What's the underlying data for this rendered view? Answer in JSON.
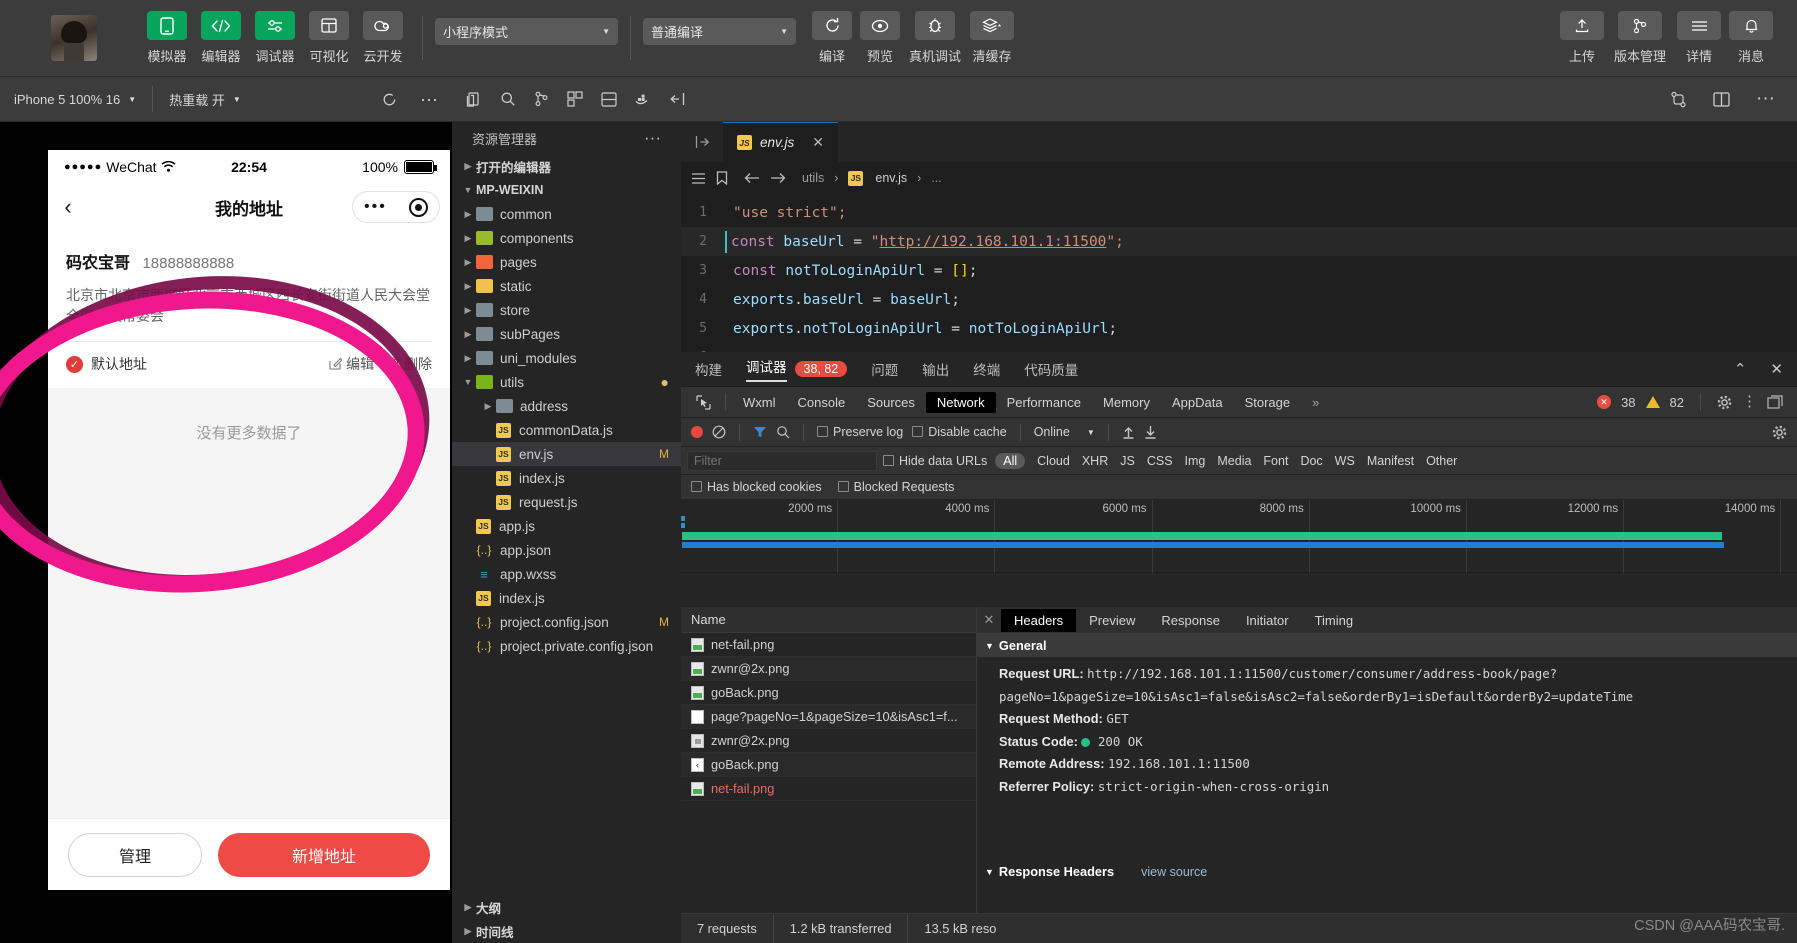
{
  "toolbar": {
    "items": [
      {
        "label": "模拟器",
        "icon": "phone-icon",
        "style": "green"
      },
      {
        "label": "编辑器",
        "icon": "code-icon",
        "style": "green"
      },
      {
        "label": "调试器",
        "icon": "debug-slider-icon",
        "style": "green"
      },
      {
        "label": "可视化",
        "icon": "layout-icon",
        "style": "grey"
      },
      {
        "label": "云开发",
        "icon": "cloud-icon",
        "style": "grey"
      }
    ],
    "mode_select": "小程序模式",
    "compile_select": "普通编译",
    "actions": [
      {
        "label": "编译",
        "icon": "refresh-icon"
      },
      {
        "label": "预览",
        "icon": "eye-icon"
      },
      {
        "label": "真机调试",
        "icon": "bug-icon"
      },
      {
        "label": "清缓存",
        "icon": "layers-icon"
      }
    ],
    "right_actions": [
      {
        "label": "上传",
        "icon": "upload-icon"
      },
      {
        "label": "版本管理",
        "icon": "git-branch-icon"
      },
      {
        "label": "详情",
        "icon": "menu-icon"
      },
      {
        "label": "消息",
        "icon": "bell-icon"
      }
    ]
  },
  "row2": {
    "device": "iPhone 5 100% 16",
    "hotreload": "热重载 开",
    "refresh_icon": "refresh-icon",
    "more_icon": "more-icon",
    "editor_icons": [
      "new-file-icon",
      "search-icon",
      "source-control-icon",
      "extensions-icon",
      "split-layout-icon",
      "docker-icon"
    ],
    "collapse_icon": "collapse-panel-icon",
    "right_icons": [
      "compare-icon",
      "split-editor-icon",
      "more-icon"
    ]
  },
  "simulator": {
    "status_bar": {
      "carrier_dots": "●●●●●",
      "carrier": "WeChat",
      "wifi_icon": "wifi-icon",
      "time": "22:54",
      "battery": "100%"
    },
    "nav": {
      "back_icon": "chevron-left-icon",
      "title": "我的地址",
      "capsule_dots": "•••",
      "capsule_circle_icon": "target-icon"
    },
    "address": {
      "name": "码农宝哥",
      "phone": "18888888888",
      "detail": "北京市北京市西城区北京市西城区西长安街街道人民大会堂全国人大常委会",
      "default_label": "默认地址",
      "default_icon": "check-circle-icon",
      "edit_label": "编辑",
      "edit_icon": "edit-icon",
      "delete_label": "删除",
      "delete_icon": "trash-icon"
    },
    "no_more": "没有更多数据了",
    "buttons": {
      "manage": "管理",
      "add": "新增地址"
    }
  },
  "explorer": {
    "title": "资源管理器",
    "more_icon": "more-icon",
    "sections": {
      "open_editors": "打开的编辑器",
      "project": "MP-WEIXIN",
      "outline": "大纲",
      "timeline": "时间线"
    },
    "tree": [
      {
        "label": "common",
        "type": "folder",
        "color": "blue",
        "depth": 1,
        "arrow": "collapsed"
      },
      {
        "label": "components",
        "type": "folder",
        "color": "green",
        "depth": 1,
        "arrow": "collapsed"
      },
      {
        "label": "pages",
        "type": "folder",
        "color": "red",
        "depth": 1,
        "arrow": "collapsed"
      },
      {
        "label": "static",
        "type": "folder",
        "color": "yellow",
        "depth": 1,
        "arrow": "collapsed"
      },
      {
        "label": "store",
        "type": "folder",
        "color": "blue",
        "depth": 1,
        "arrow": "collapsed"
      },
      {
        "label": "subPages",
        "type": "folder",
        "color": "blue",
        "depth": 1,
        "arrow": "collapsed"
      },
      {
        "label": "uni_modules",
        "type": "folder",
        "color": "blue",
        "depth": 1,
        "arrow": "collapsed"
      },
      {
        "label": "utils",
        "type": "folder",
        "color": "green2",
        "depth": 1,
        "arrow": "expanded",
        "modified_dot": true
      },
      {
        "label": "address",
        "type": "folder",
        "color": "blue",
        "depth": 2,
        "arrow": "collapsed"
      },
      {
        "label": "commonData.js",
        "type": "js",
        "depth": 2
      },
      {
        "label": "env.js",
        "type": "js",
        "depth": 2,
        "selected": true,
        "flag": "M"
      },
      {
        "label": "index.js",
        "type": "js",
        "depth": 2
      },
      {
        "label": "request.js",
        "type": "js",
        "depth": 2
      },
      {
        "label": "app.js",
        "type": "js",
        "depth": 1
      },
      {
        "label": "app.json",
        "type": "json",
        "depth": 1
      },
      {
        "label": "app.wxss",
        "type": "css",
        "depth": 1
      },
      {
        "label": "index.js",
        "type": "js",
        "depth": 1
      },
      {
        "label": "project.config.json",
        "type": "json",
        "depth": 1,
        "flag": "M"
      },
      {
        "label": "project.private.config.json",
        "type": "json",
        "depth": 1
      }
    ]
  },
  "editor": {
    "tab": {
      "name": "env.js",
      "icon": "js-icon",
      "close_icon": "close-icon"
    },
    "breadcrumb": [
      "utils",
      "env.js",
      "..."
    ],
    "breadcrumb_icons": [
      "outline-icon",
      "bookmark-icon",
      "back-arrow-icon",
      "forward-arrow-icon"
    ],
    "lines": [
      {
        "n": "1",
        "tokens": [
          {
            "t": "\"use strict\";",
            "c": "k-str"
          }
        ]
      },
      {
        "n": "2",
        "tokens": [
          {
            "t": "const",
            "c": "k-kw"
          },
          {
            "t": " ",
            "c": "k-op"
          },
          {
            "t": "baseUrl",
            "c": "k-var"
          },
          {
            "t": " = ",
            "c": "k-op"
          },
          {
            "t": "\"",
            "c": "k-str"
          },
          {
            "t": "http://192.168.101.1:11500",
            "c": "k-url"
          },
          {
            "t": "\";",
            "c": "k-str"
          }
        ],
        "current": true
      },
      {
        "n": "3",
        "tokens": [
          {
            "t": "const",
            "c": "k-kw"
          },
          {
            "t": " ",
            "c": "k-op"
          },
          {
            "t": "notToLoginApiUrl",
            "c": "k-var"
          },
          {
            "t": " = ",
            "c": "k-op"
          },
          {
            "t": "[]",
            "c": "k-br"
          },
          {
            "t": ";",
            "c": "k-op"
          }
        ]
      },
      {
        "n": "4",
        "tokens": [
          {
            "t": "exports",
            "c": "k-var"
          },
          {
            "t": ".",
            "c": "k-op"
          },
          {
            "t": "baseUrl",
            "c": "k-prop"
          },
          {
            "t": " = ",
            "c": "k-op"
          },
          {
            "t": "baseUrl",
            "c": "k-var"
          },
          {
            "t": ";",
            "c": "k-op"
          }
        ]
      },
      {
        "n": "5",
        "tokens": [
          {
            "t": "exports",
            "c": "k-var"
          },
          {
            "t": ".",
            "c": "k-op"
          },
          {
            "t": "notToLoginApiUrl",
            "c": "k-prop"
          },
          {
            "t": " = ",
            "c": "k-op"
          },
          {
            "t": "notToLoginApiUrl",
            "c": "k-var"
          },
          {
            "t": ";",
            "c": "k-op"
          }
        ]
      },
      {
        "n": "6",
        "tokens": [
          {
            "t": "",
            "c": "k-op"
          }
        ]
      }
    ]
  },
  "debugger": {
    "panel_tabs": [
      {
        "label": "构建"
      },
      {
        "label": "调试器",
        "active": true,
        "badge": "38, 82"
      },
      {
        "label": "问题"
      },
      {
        "label": "输出"
      },
      {
        "label": "终端"
      },
      {
        "label": "代码质量"
      }
    ],
    "panel_right_icons": [
      "chevron-up-icon",
      "close-icon"
    ],
    "devtools_tabs": [
      "Wxml",
      "Console",
      "Sources",
      "Network",
      "Performance",
      "Memory",
      "AppData",
      "Storage"
    ],
    "devtools_active": "Network",
    "devtools_overflow": "»",
    "error_count": "38",
    "warning_count": "82",
    "devtools_right_icons": [
      "settings-gear-icon",
      "kebab-menu-icon",
      "dock-icon"
    ],
    "network": {
      "toolbar": {
        "record_icon": "record-icon",
        "clear_icon": "clear-icon",
        "filter_icon": "filter-icon",
        "search_icon": "search-icon",
        "preserve_log": "Preserve log",
        "disable_cache": "Disable cache",
        "throttle": "Online",
        "import_icon": "upload-arrow-icon",
        "export_icon": "download-arrow-icon",
        "settings_icon": "settings-gear-icon"
      },
      "filter_placeholder": "Filter",
      "hide_data_urls": "Hide data URLs",
      "types": [
        "All",
        "Cloud",
        "XHR",
        "JS",
        "CSS",
        "Img",
        "Media",
        "Font",
        "Doc",
        "WS",
        "Manifest",
        "Other"
      ],
      "active_type": "All",
      "has_blocked_cookies": "Has blocked cookies",
      "blocked_requests": "Blocked Requests",
      "timeline_ticks": [
        "2000 ms",
        "4000 ms",
        "6000 ms",
        "8000 ms",
        "10000 ms",
        "12000 ms",
        "14000 ms"
      ],
      "column_header": "Name",
      "requests": [
        {
          "name": "net-fail.png",
          "icon": "image-icon"
        },
        {
          "name": "zwnr@2x.png",
          "icon": "image-icon"
        },
        {
          "name": "goBack.png",
          "icon": "image-icon"
        },
        {
          "name": "page?pageNo=1&pageSize=10&isAsc1=f...",
          "icon": "doc-icon"
        },
        {
          "name": "zwnr@2x.png",
          "icon": "grey-image-icon"
        },
        {
          "name": "goBack.png",
          "icon": "back-image-icon"
        },
        {
          "name": "net-fail.png",
          "icon": "image-icon",
          "error": true
        }
      ],
      "detail_tabs": [
        "Headers",
        "Preview",
        "Response",
        "Initiator",
        "Timing"
      ],
      "detail_active": "Headers",
      "detail_close_icon": "close-icon",
      "general_section": "General",
      "general": [
        {
          "key": "Request URL:",
          "value": "http://192.168.101.1:11500/customer/consumer/address-book/page?pageNo=1&pageSize=10&isAsc1=false&isAsc2=false&orderBy1=isDefault&orderBy2=updateTime"
        },
        {
          "key": "Request Method:",
          "value": "GET"
        },
        {
          "key": "Status Code:",
          "value": "200 OK",
          "status_dot": true
        },
        {
          "key": "Remote Address:",
          "value": "192.168.101.1:11500"
        },
        {
          "key": "Referrer Policy:",
          "value": "strict-origin-when-cross-origin"
        }
      ],
      "response_headers_section": "Response Headers",
      "view_source": "view source",
      "footer": {
        "requests": "7 requests",
        "transferred": "1.2 kB transferred",
        "resources": "13.5 kB reso"
      }
    }
  },
  "watermark": "CSDN @AAA码农宝哥."
}
